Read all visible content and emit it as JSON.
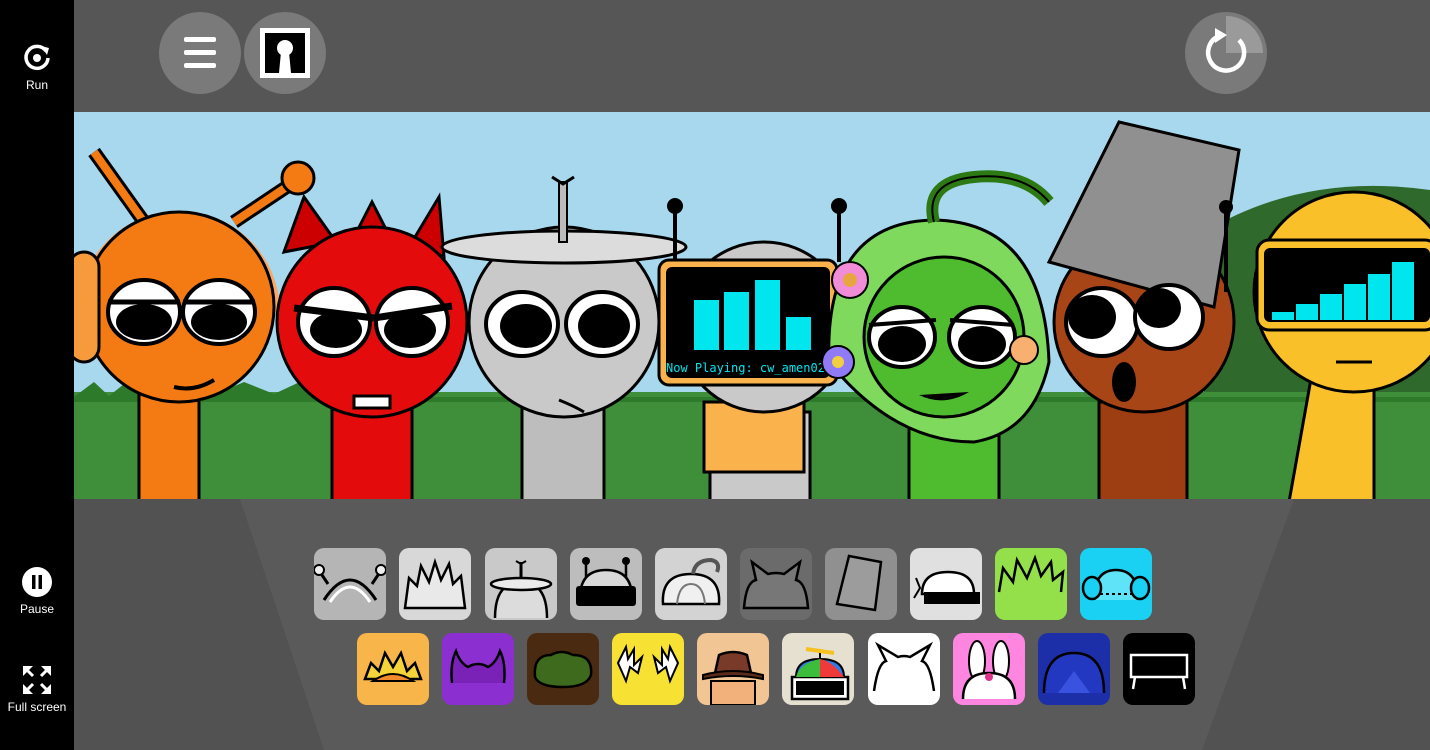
{
  "sidebar": {
    "run_label": "Run",
    "pause_label": "Pause",
    "fullscreen_label": "Full screen"
  },
  "topbar": {
    "menu_icon": "hamburger-menu-icon",
    "keyhole_icon": "keyhole-icon",
    "reset_icon": "restart-icon"
  },
  "stage": {
    "now_playing": "Now Playing: cw_amen02",
    "characters": [
      "orange-headphones",
      "red-devil",
      "gray-antenna-plate",
      "tv-screen-bot",
      "green-vine-hair",
      "brown-bucket",
      "yellow-visor"
    ]
  },
  "palette": {
    "row1": [
      {
        "name": "antenna-arch",
        "bg": "#b5b5b5"
      },
      {
        "name": "spiky-hair",
        "bg": "#d8d8d8"
      },
      {
        "name": "antenna-disc",
        "bg": "#c9c9c9"
      },
      {
        "name": "screen-antennas",
        "bg": "#bdbdbd"
      },
      {
        "name": "pumpkin-vine",
        "bg": "#d3d3d3"
      },
      {
        "name": "cat-ears-dark",
        "bg": "#6b6b6b"
      },
      {
        "name": "bucket",
        "bg": "#909090"
      },
      {
        "name": "cap-visor",
        "bg": "#e0e0e0"
      },
      {
        "name": "green-spikes",
        "bg": "#94e04a"
      },
      {
        "name": "cyan-headphones",
        "bg": "#1ad0f3"
      }
    ],
    "row2": [
      {
        "name": "sun-crown",
        "bg": "#f7b54a"
      },
      {
        "name": "purple-horns",
        "bg": "#8b2fd1"
      },
      {
        "name": "brown-bush",
        "bg": "#4a2a10"
      },
      {
        "name": "yellow-lightning",
        "bg": "#f7e234"
      },
      {
        "name": "fedora",
        "bg": "#f2c594"
      },
      {
        "name": "propeller-cap",
        "bg": "#e5e0d0"
      },
      {
        "name": "white-cat-ears",
        "bg": "#ffffff"
      },
      {
        "name": "bunny-ears",
        "bg": "#ff86e0"
      },
      {
        "name": "blue-dome",
        "bg": "#1c2fa8"
      },
      {
        "name": "black-frame",
        "bg": "#000000"
      }
    ]
  }
}
